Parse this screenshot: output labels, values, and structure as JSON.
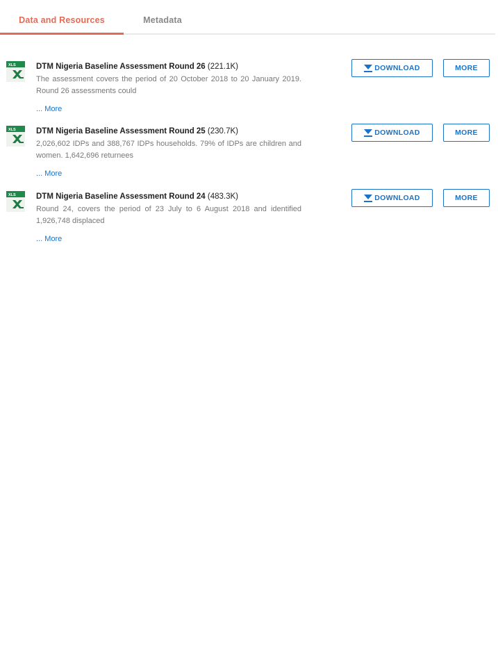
{
  "tabs": [
    {
      "label": "Data and Resources",
      "active": true
    },
    {
      "label": "Metadata",
      "active": false
    }
  ],
  "colors": {
    "accent": "#e56a54",
    "link": "#1a73c8",
    "excel_green": "#1e7b45"
  },
  "resources": [
    {
      "icon": "xls-file-icon",
      "icon_label": "XLS",
      "title": "DTM Nigeria Baseline Assessment Round 26",
      "size": "(221.1K)",
      "description": "The assessment covers the period of 20 October 2018 to 20 January 2019. Round 26 assessments could",
      "more_label": "... More",
      "download_label": "DOWNLOAD",
      "more_button_label": "MORE"
    },
    {
      "icon": "xls-file-icon",
      "icon_label": "XLS",
      "title": "DTM Nigeria Baseline Assessment Round 25",
      "size": "(230.7K)",
      "description": "2,026,602 IDPs and 388,767 IDPs households. 79% of IDPs are children and women. 1,642,696 returnees",
      "more_label": "... More",
      "download_label": "DOWNLOAD",
      "more_button_label": "MORE"
    },
    {
      "icon": "xls-file-icon",
      "icon_label": "XLS",
      "title": "DTM Nigeria Baseline Assessment Round 24",
      "size": "(483.3K)",
      "description": "Round 24, covers the period of 23 July to 6 August 2018 and identified 1,926,748 displaced",
      "more_label": "... More",
      "download_label": "DOWNLOAD",
      "more_button_label": "MORE"
    }
  ]
}
